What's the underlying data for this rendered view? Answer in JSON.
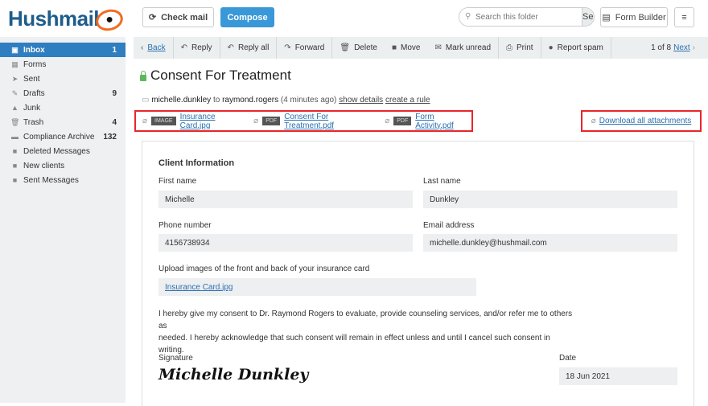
{
  "header": {
    "logo": "Hushmail",
    "check_mail": "Check mail",
    "compose": "Compose",
    "search_placeholder": "Search this folder",
    "search_button": "Search",
    "form_builder": "Form Builder"
  },
  "sidebar": {
    "items": [
      {
        "label": "Inbox",
        "count": "1",
        "icon": "inbox-icon",
        "active": true
      },
      {
        "label": "Forms",
        "count": "",
        "icon": "forms-icon"
      },
      {
        "label": "Sent",
        "count": "",
        "icon": "send-icon"
      },
      {
        "label": "Drafts",
        "count": "9",
        "icon": "pencil-icon"
      },
      {
        "label": "Junk",
        "count": "",
        "icon": "warning-icon"
      },
      {
        "label": "Trash",
        "count": "4",
        "icon": "trash-icon"
      },
      {
        "label": "Compliance Archive",
        "count": "132",
        "icon": "archive-icon"
      },
      {
        "label": "Deleted Messages",
        "count": "",
        "icon": "folder-icon"
      },
      {
        "label": "New clients",
        "count": "",
        "icon": "folder-icon"
      },
      {
        "label": "Sent Messages",
        "count": "",
        "icon": "folder-icon"
      }
    ]
  },
  "toolbar": {
    "back": "Back",
    "reply": "Reply",
    "reply_all": "Reply all",
    "forward": "Forward",
    "delete": "Delete",
    "move": "Move",
    "mark_unread": "Mark unread",
    "print": "Print",
    "report_spam": "Report spam",
    "pager": "1 of 8",
    "next": "Next"
  },
  "message": {
    "subject": "Consent For Treatment",
    "from": "michelle.dunkley",
    "to_word": "to",
    "to": "raymond.rogers",
    "time": "(4 minutes ago)",
    "show_details": "show details",
    "create_rule": "create a rule",
    "attachments": [
      {
        "type": "IMAGE",
        "name": "Insurance Card.jpg"
      },
      {
        "type": "PDF",
        "name": "Consent For Treatment.pdf"
      },
      {
        "type": "PDF",
        "name": "Form Activity.pdf"
      }
    ],
    "download_all": "Download all attachments"
  },
  "form": {
    "section": "Client Information",
    "first_name_label": "First name",
    "first_name": "Michelle",
    "last_name_label": "Last name",
    "last_name": "Dunkley",
    "phone_label": "Phone number",
    "phone": "4156738934",
    "email_label": "Email address",
    "email": "michelle.dunkley@hushmail.com",
    "upload_label": "Upload images of the front and back of your insurance card",
    "upload_file": "Insurance Card.jpg",
    "consent_line1": "I hereby give my consent to Dr. Raymond Rogers to evaluate, provide counseling services, and/or refer me to others as",
    "consent_line2": "needed. I hereby acknowledge that such consent will remain in effect unless and until I cancel such consent in writing.",
    "signature_label": "Signature",
    "signature": "Michelle Dunkley",
    "date_label": "Date",
    "date": "18 Jun 2021"
  },
  "colors": {
    "accent": "#2f7ebf",
    "compose": "#3a98d8",
    "highlight": "#e8262a",
    "logo_ring": "#f26b21"
  }
}
